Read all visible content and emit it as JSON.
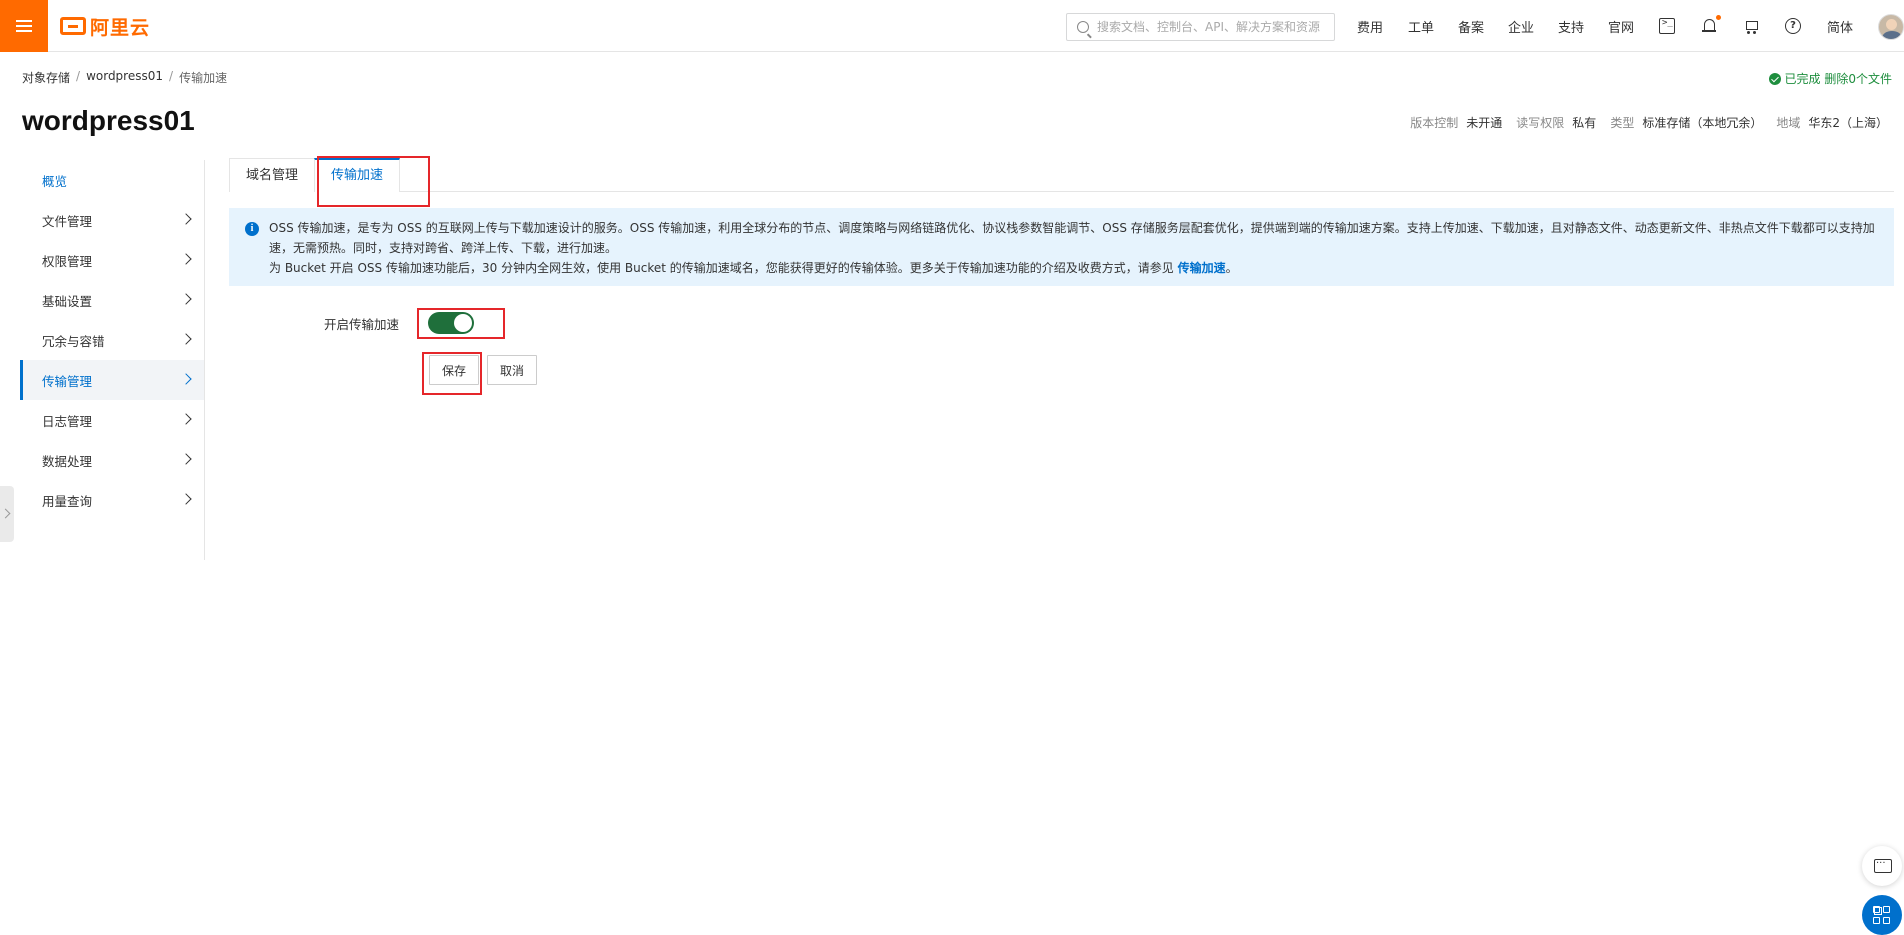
{
  "header": {
    "logo_text": "阿里云",
    "search_placeholder": "搜索文档、控制台、API、解决方案和资源",
    "nav": [
      "费用",
      "工单",
      "备案",
      "企业",
      "支持",
      "官网"
    ],
    "lang": "简体",
    "brand_color": "#ff6a00"
  },
  "breadcrumb": [
    "对象存储",
    "wordpress01",
    "传输加速"
  ],
  "status_text": "已完成 删除0个文件",
  "page_title": "wordpress01",
  "meta": [
    {
      "key": "版本控制",
      "value": "未开通"
    },
    {
      "key": "读写权限",
      "value": "私有"
    },
    {
      "key": "类型",
      "value": "标准存储（本地冗余）"
    },
    {
      "key": "地域",
      "value": "华东2（上海）"
    }
  ],
  "sidebar": {
    "items": [
      {
        "label": "概览"
      },
      {
        "label": "文件管理"
      },
      {
        "label": "权限管理"
      },
      {
        "label": "基础设置"
      },
      {
        "label": "冗余与容错"
      },
      {
        "label": "传输管理"
      },
      {
        "label": "日志管理"
      },
      {
        "label": "数据处理"
      },
      {
        "label": "用量查询"
      }
    ],
    "active_index": 5
  },
  "tabs": [
    {
      "label": "域名管理"
    },
    {
      "label": "传输加速"
    }
  ],
  "banner": {
    "line1": "OSS 传输加速，是专为 OSS 的互联网上传与下载加速设计的服务。OSS 传输加速，利用全球分布的节点、调度策略与网络链路优化、协议栈参数智能调节、OSS 存储服务层配套优化，提供端到端的传输加速方案。支持上传加速、下载加速，且对静态文件、动态更新文件、非热点文件下载都可以支持加速，无需预热。同时，支持对跨省、跨洋上传、下载，进行加速。",
    "line2": "为 Bucket 开启 OSS 传输加速功能后，30 分钟内全网生效，使用 Bucket 的传输加速域名，您能获得更好的传输体验。更多关于传输加速功能的介绍及收费方式，请参见 ",
    "link": "传输加速",
    "line2_end": "。"
  },
  "form": {
    "label": "开启传输加速",
    "switch_on": true,
    "save_label": "保存",
    "cancel_label": "取消"
  },
  "accent_color": "#0070cc",
  "highlight_color": "#e5262a"
}
